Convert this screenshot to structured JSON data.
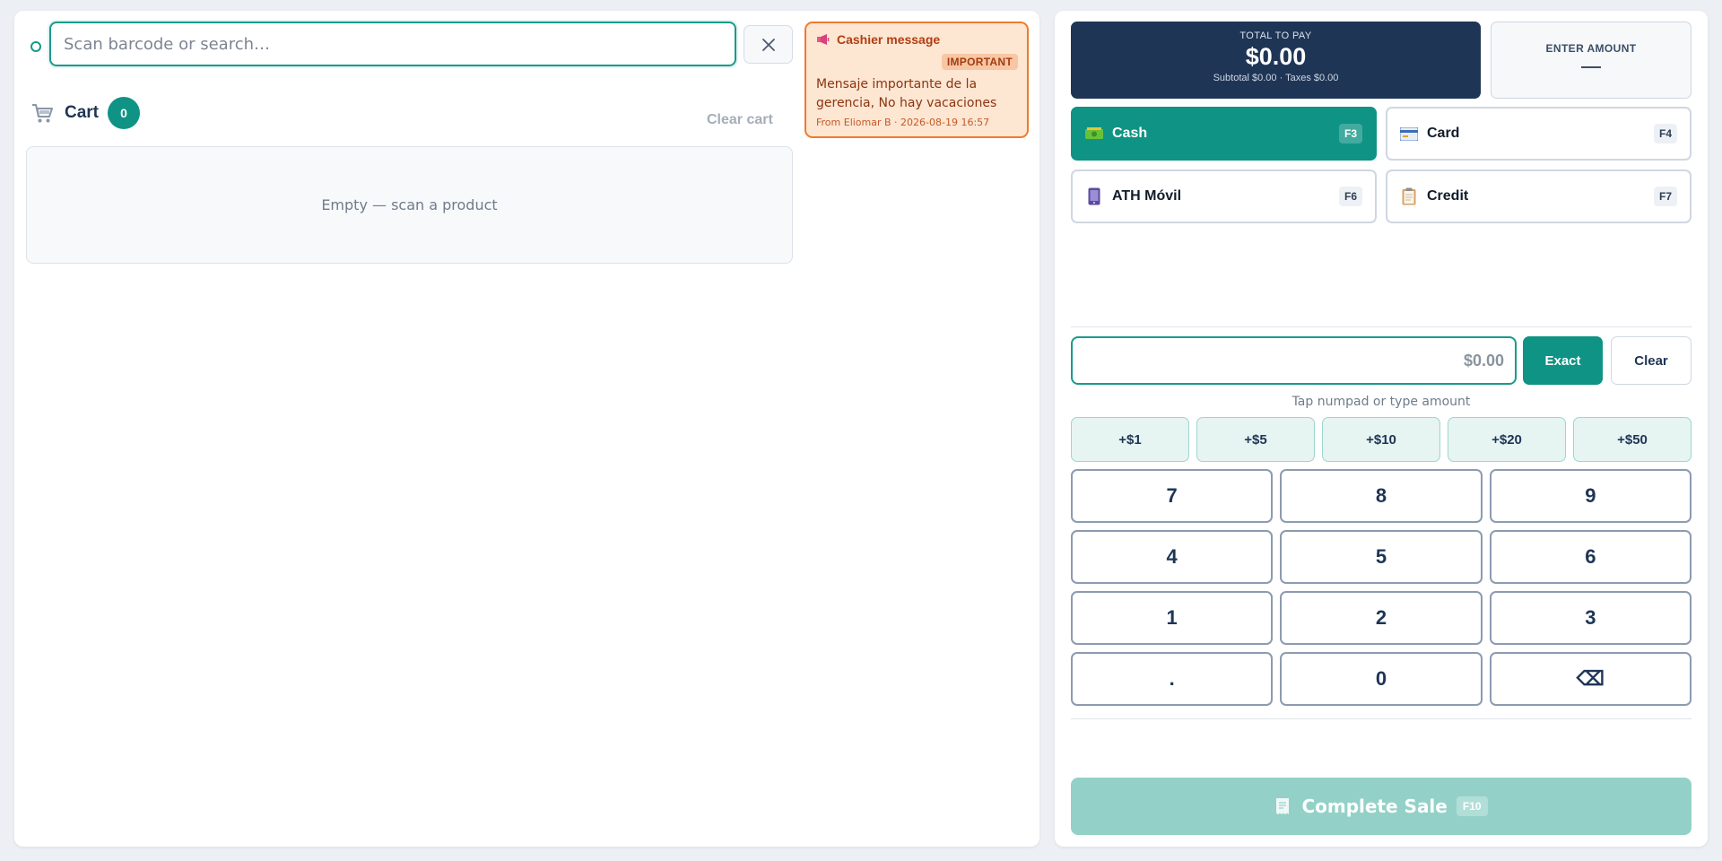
{
  "search": {
    "placeholder": "Scan barcode or search…"
  },
  "cart": {
    "title": "Cart",
    "count": "0",
    "clear_label": "Clear cart",
    "empty_text": "Empty — scan a product"
  },
  "cashier_message": {
    "title": "Cashier message",
    "badge": "IMPORTANT",
    "body": "Mensaje importante de la gerencia, No hay vacaciones",
    "from": "From Eliomar B · 2026-08-19 16:57"
  },
  "total": {
    "label": "TOTAL TO PAY",
    "amount": "$0.00",
    "subtitle": "Subtotal $0.00 · Taxes $0.00"
  },
  "enter_amount": {
    "label": "ENTER AMOUNT"
  },
  "payment_methods": [
    {
      "label": "Cash",
      "key": "F3",
      "icon": "cash-icon",
      "active": true
    },
    {
      "label": "Card",
      "key": "F4",
      "icon": "credit-card-icon",
      "active": false
    },
    {
      "label": "ATH Móvil",
      "key": "F6",
      "icon": "phone-icon",
      "active": false
    },
    {
      "label": "Credit",
      "key": "F7",
      "icon": "clipboard-icon",
      "active": false
    }
  ],
  "amount": {
    "placeholder": "$0.00",
    "exact_label": "Exact",
    "clear_label": "Clear",
    "hint": "Tap numpad or type amount"
  },
  "quick_amounts": [
    "+$1",
    "+$5",
    "+$10",
    "+$20",
    "+$50"
  ],
  "numpad": [
    "7",
    "8",
    "9",
    "4",
    "5",
    "6",
    "1",
    "2",
    "3",
    ".",
    "0",
    "⌫"
  ],
  "complete": {
    "label": "Complete Sale",
    "key": "F10"
  },
  "colors": {
    "accent": "#0f9384",
    "navy": "#1f3556",
    "message_bg": "#fde6d2",
    "message_border": "#ef7b2d"
  }
}
